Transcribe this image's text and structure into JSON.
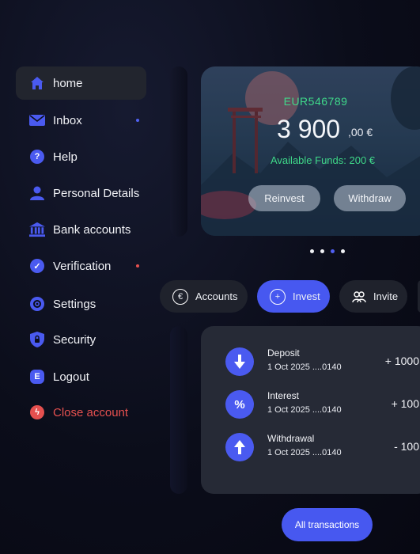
{
  "sidebar": {
    "items": [
      {
        "label": "home",
        "active": true
      },
      {
        "label": "Inbox",
        "dot_color": "#5061f2"
      },
      {
        "label": "Help"
      },
      {
        "label": "Personal Details"
      },
      {
        "label": "Bank accounts"
      },
      {
        "label": "Verification",
        "dot_color": "#e5504f"
      },
      {
        "label": "Settings"
      },
      {
        "label": "Security"
      },
      {
        "label": "Logout"
      },
      {
        "label": "Close account",
        "danger": true
      }
    ]
  },
  "card": {
    "account_id": "EUR546789",
    "amount": "3 900",
    "cents": ",00 €",
    "available_funds": "Available Funds: 200 €",
    "reinvest_label": "Reinvest",
    "withdraw_label": "Withdraw"
  },
  "pager": {
    "count": 4,
    "active_index": 2
  },
  "actions": [
    {
      "label": "Accounts",
      "icon": "euro-icon"
    },
    {
      "label": "Invest",
      "icon": "plus-icon",
      "primary": true
    },
    {
      "label": "Invite",
      "icon": "people-icon"
    }
  ],
  "transactions": [
    {
      "title": "Deposit",
      "date": "1 Oct 2025 ....0140",
      "amount": "+ 1000",
      "icon": "arrow-down-icon"
    },
    {
      "title": "Interest",
      "date": "1 Oct 2025 ....0140",
      "amount": "+ 100",
      "icon": "percent-icon"
    },
    {
      "title": "Withdrawal",
      "date": "1 Oct 2025 ....0140",
      "amount": "- 100",
      "icon": "arrow-up-icon"
    }
  ],
  "all_transactions_label": "All transactions",
  "colors": {
    "accent": "#4758f0",
    "success": "#3fd98a",
    "danger": "#e5504f"
  }
}
